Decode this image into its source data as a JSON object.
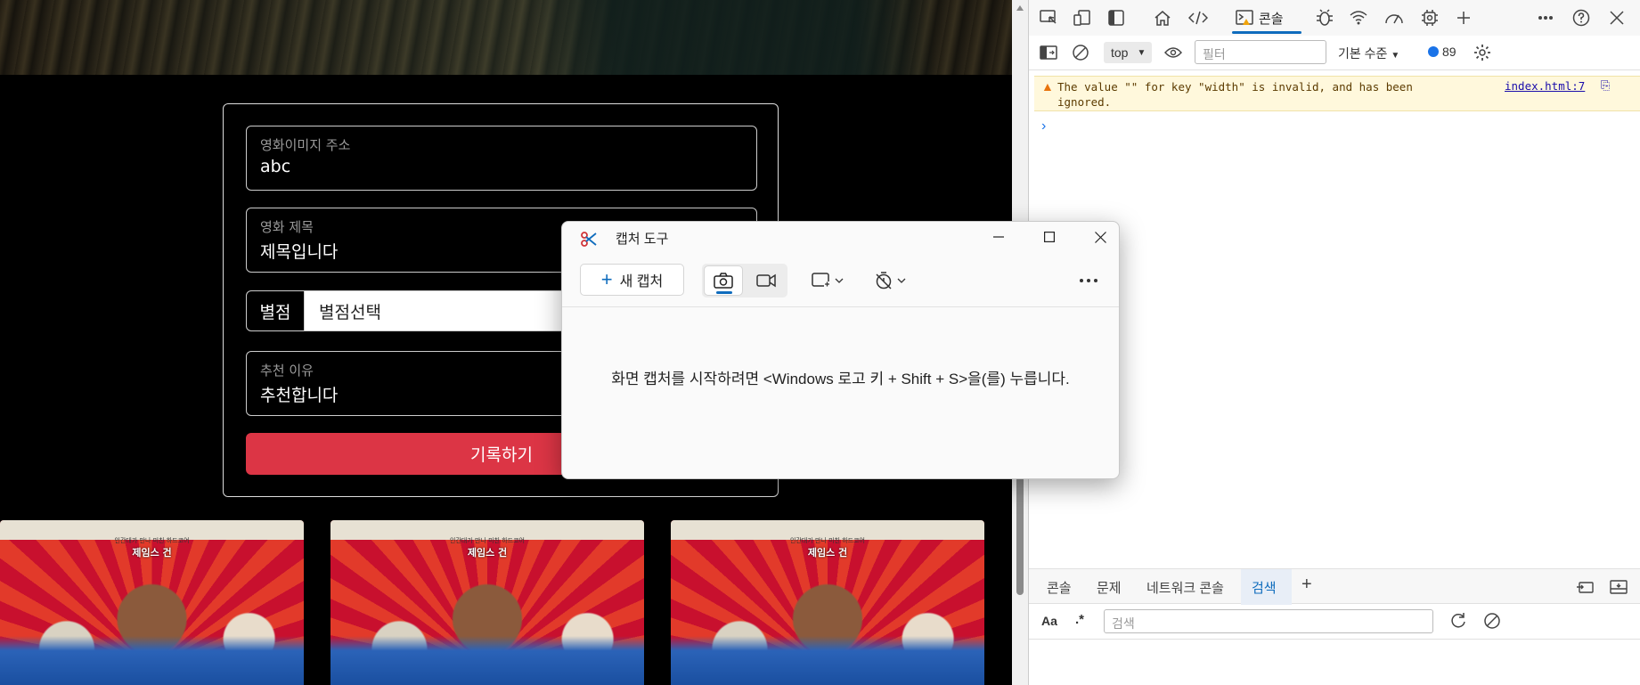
{
  "form": {
    "image_url": {
      "label": "영화이미지 주소",
      "value": "abc"
    },
    "title": {
      "label": "영화 제목",
      "value": "제목입니다"
    },
    "rating": {
      "label": "별점",
      "value": "별점선택"
    },
    "reason": {
      "label": "추천 이유",
      "value": "추천합니다"
    },
    "submit_label": "기록하기"
  },
  "posters": [
    {
      "pre": "인간대가 만나 미친 하드코어",
      "title": "제임스 건"
    },
    {
      "pre": "인간대가 만나 미친 하드코어",
      "title": "제임스 건"
    },
    {
      "pre": "인간대가 만나 미친 하드코어",
      "title": "제임스 건"
    }
  ],
  "snipping_tool": {
    "title": "캡처 도구",
    "new_capture": "새 캡처",
    "message": "화면 캡처를 시작하려면 <Windows 로고 키 + Shift + S>을(를) 누릅니다."
  },
  "devtools": {
    "console_tab": "콘솔",
    "context": "top",
    "filter_placeholder": "필터",
    "level": "기본 수준",
    "message_count": "89",
    "warning": {
      "text": "The value \"\" for key \"width\" is invalid, and has been ignored.",
      "source": "index.html:7"
    },
    "drawer_tabs": [
      "콘솔",
      "문제",
      "네트워크 콘솔",
      "검색"
    ],
    "search_placeholder": "검색",
    "search_case": "Aa",
    "search_regex": ".*"
  },
  "colors": {
    "submit": "#dc3545",
    "accent": "#0f6cbd",
    "warning_bg": "#fff8dc"
  }
}
